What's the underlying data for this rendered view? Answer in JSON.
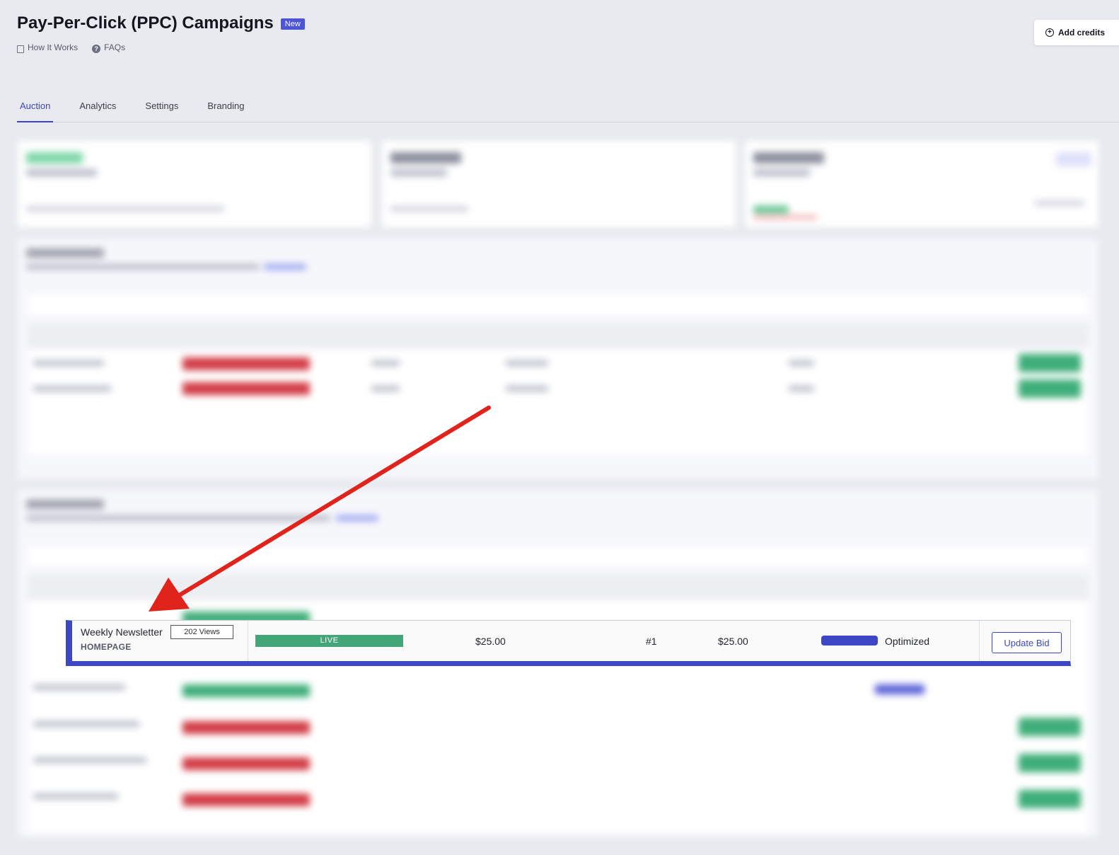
{
  "header": {
    "title": "Pay-Per-Click (PPC) Campaigns",
    "badge": "New",
    "how_it_works": "How It Works",
    "faqs": "FAQs",
    "add_credits": "Add credits"
  },
  "tabs": [
    {
      "label": "Auction",
      "active": true
    },
    {
      "label": "Analytics",
      "active": false
    },
    {
      "label": "Settings",
      "active": false
    },
    {
      "label": "Branding",
      "active": false
    }
  ],
  "highlighted_row": {
    "name": "Weekly Newsletter",
    "views": "202 Views",
    "placement": "HOMEPAGE",
    "status": "LIVE",
    "bid": "$25.00",
    "rank": "#1",
    "cost": "$25.00",
    "recommendation": "Optimized",
    "action": "Update Bid"
  },
  "colors": {
    "accent": "#3d47c6",
    "live": "#43a679",
    "paused": "#d23b45",
    "arrow": "#e0231b"
  },
  "icons": {
    "how_it_works": "doc-icon",
    "faqs": "question-icon",
    "add_credits": "plus-circle-icon",
    "annotation": "red-arrow"
  }
}
